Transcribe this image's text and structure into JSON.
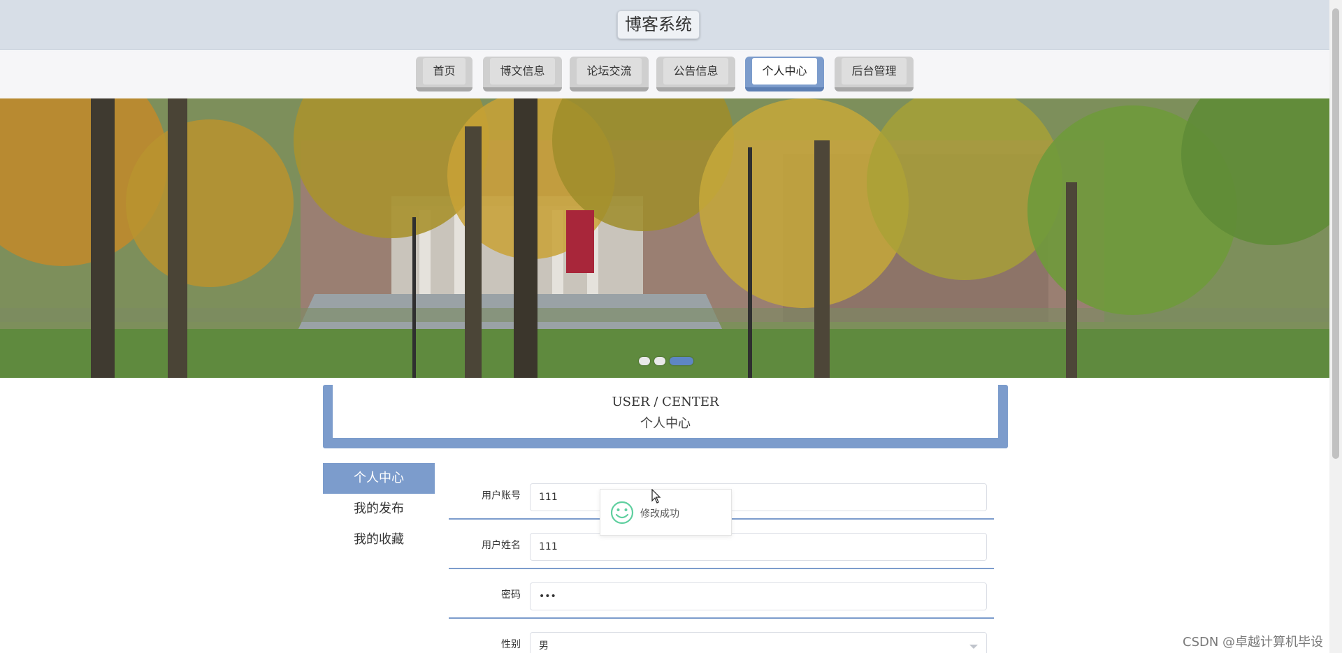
{
  "site": {
    "title": "博客系统"
  },
  "nav": {
    "items": [
      {
        "label": "首页"
      },
      {
        "label": "博文信息"
      },
      {
        "label": "论坛交流"
      },
      {
        "label": "公告信息"
      },
      {
        "label": "个人中心"
      },
      {
        "label": "后台管理"
      }
    ],
    "active": "个人中心"
  },
  "banner": {
    "slides": 3,
    "active_slide": 3
  },
  "section": {
    "en": "USER / CENTER",
    "cn": "个人中心"
  },
  "side_menu": {
    "items": [
      {
        "label": "个人中心"
      },
      {
        "label": "我的发布"
      },
      {
        "label": "我的收藏"
      }
    ],
    "active": "个人中心"
  },
  "form": {
    "fields": [
      {
        "label": "用户账号",
        "value": "111"
      },
      {
        "label": "用户姓名",
        "value": "111"
      },
      {
        "label": "密码",
        "value": "•••"
      },
      {
        "label": "性别",
        "value": "男"
      }
    ]
  },
  "toast": {
    "text": "修改成功",
    "icon": "smile-icon"
  },
  "watermark": "CSDN @卓越计算机毕设",
  "colors": {
    "accent": "#7c9ccc",
    "header_bg": "#d7dee7",
    "toast_icon": "#5fcf9f"
  }
}
